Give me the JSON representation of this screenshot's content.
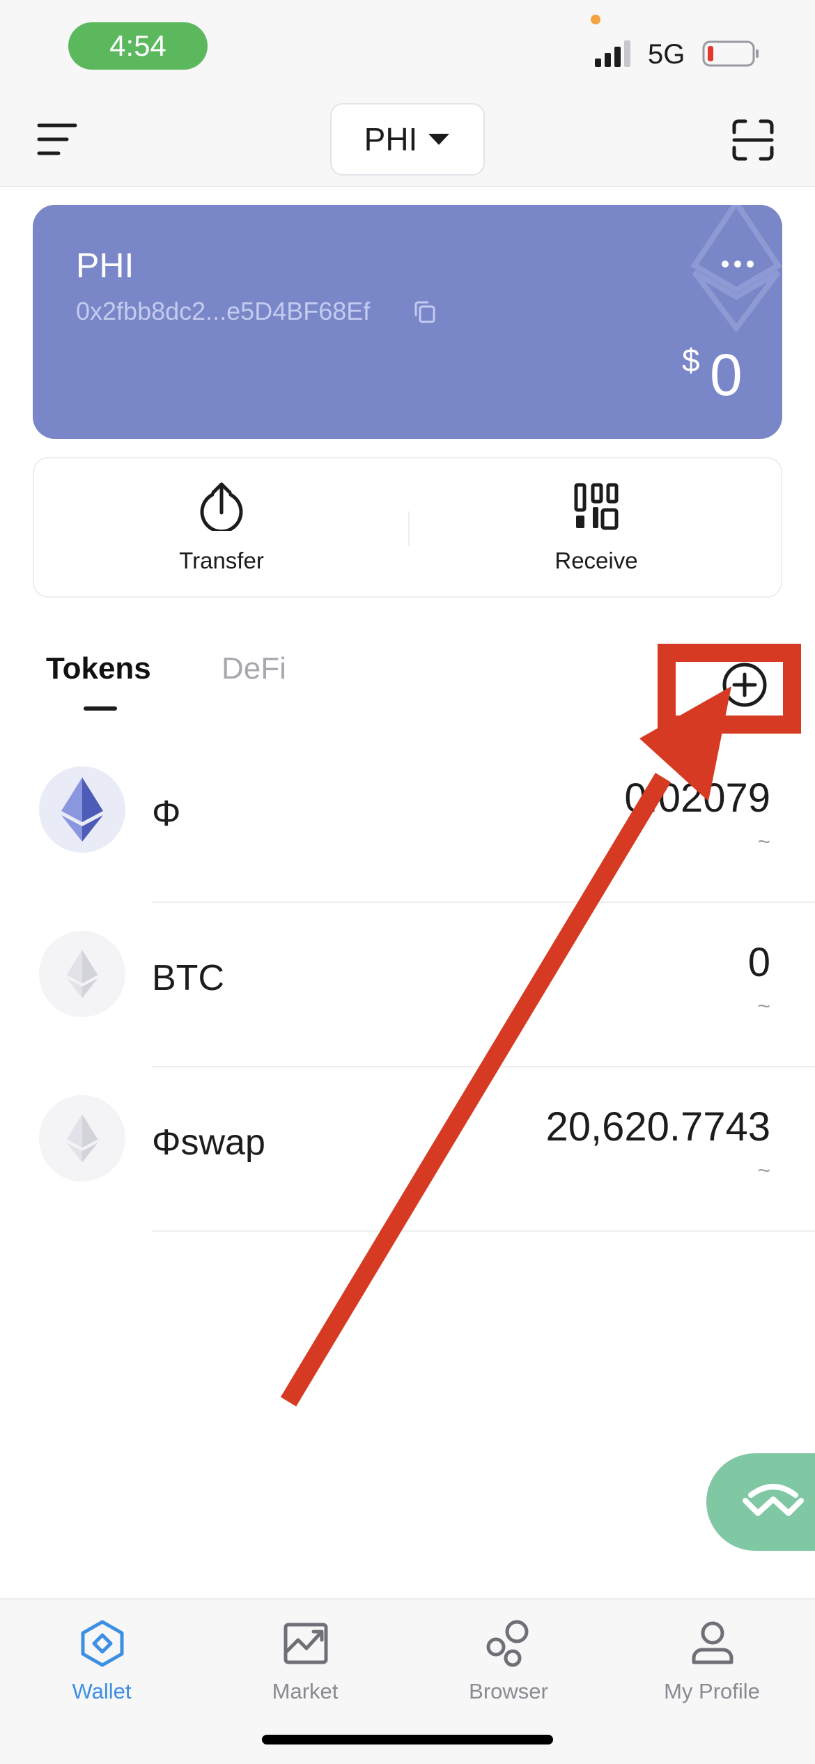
{
  "status_bar": {
    "time": "4:54",
    "network": "5G"
  },
  "header": {
    "wallet_name": "PHI"
  },
  "wallet_card": {
    "name": "PHI",
    "address": "0x2fbb8dc2...e5D4BF68Ef",
    "currency_symbol": "$",
    "balance": "0",
    "more_label": "···"
  },
  "actions": [
    {
      "label": "Transfer",
      "icon": "upload-icon"
    },
    {
      "label": "Receive",
      "icon": "qr-code-icon"
    }
  ],
  "tabs": [
    {
      "label": "Tokens",
      "active": true
    },
    {
      "label": "DeFi",
      "active": false
    }
  ],
  "tokens": [
    {
      "name": "Φ",
      "amount": "0.02079",
      "fiat": "~",
      "icon": "ethereum-icon"
    },
    {
      "name": "BTC",
      "amount": "0",
      "fiat": "~",
      "icon": "ethereum-icon"
    },
    {
      "name": "Φswap",
      "amount": "20,620.7743",
      "fiat": "~",
      "icon": "ethereum-icon"
    }
  ],
  "bottom_nav": [
    {
      "label": "Wallet",
      "icon": "wallet-icon",
      "active": true
    },
    {
      "label": "Market",
      "icon": "market-chart-icon",
      "active": false
    },
    {
      "label": "Browser",
      "icon": "browser-bubbles-icon",
      "active": false
    },
    {
      "label": "My Profile",
      "icon": "profile-icon",
      "active": false
    }
  ],
  "colors": {
    "card_background": "#7986c8",
    "accent_blue": "#3c8fe3",
    "annotation_red": "#d63a23",
    "walletconnect_green": "#80c7a4",
    "status_time_green": "#5bb85d"
  }
}
